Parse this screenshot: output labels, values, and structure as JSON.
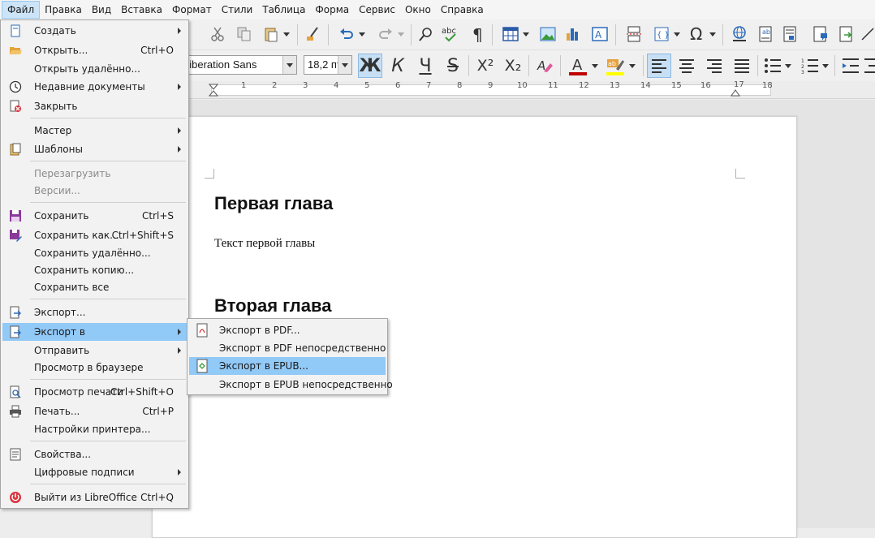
{
  "menubar": {
    "items": [
      "Файл",
      "Правка",
      "Вид",
      "Вставка",
      "Формат",
      "Стили",
      "Таблица",
      "Форма",
      "Сервис",
      "Окно",
      "Справка"
    ]
  },
  "toolbar": {
    "font_name": "Liberation Sans",
    "font_size": "18,2 пт",
    "bold_label": "Ж",
    "italic_label": "К",
    "underline_label": "Ч",
    "strike_label": "S",
    "superscript_label": "X²",
    "subscript_label": "X₂",
    "font_color": "#c00000",
    "highlight_color": "#ffff00"
  },
  "ruler": {
    "numbers": [
      "1",
      "2",
      "3",
      "4",
      "5",
      "6",
      "7",
      "8",
      "9",
      "10",
      "11",
      "12",
      "13",
      "14",
      "15",
      "16",
      "17",
      "18"
    ]
  },
  "document": {
    "heading1": "Первая глава",
    "text1": "Текст первой главы",
    "heading2": "Вторая глава"
  },
  "file_menu": {
    "items": [
      {
        "label": "Создать",
        "shortcut": "",
        "submenu": true,
        "disabled": false,
        "icon": "new-doc-icon"
      },
      {
        "label": "Открыть...",
        "shortcut": "Ctrl+O",
        "submenu": false,
        "disabled": false,
        "icon": "folder-open-icon"
      },
      {
        "label": "Открыть удалённо...",
        "shortcut": "",
        "submenu": false,
        "disabled": false,
        "icon": ""
      },
      {
        "label": "Недавние документы",
        "shortcut": "",
        "submenu": true,
        "disabled": false,
        "icon": "clock-icon"
      },
      {
        "label": "Закрыть",
        "shortcut": "",
        "submenu": false,
        "disabled": false,
        "icon": "close-doc-icon"
      },
      {
        "label": "Мастер",
        "shortcut": "",
        "submenu": true,
        "disabled": false,
        "icon": ""
      },
      {
        "label": "Шаблоны",
        "shortcut": "",
        "submenu": true,
        "disabled": false,
        "icon": "templates-icon"
      },
      {
        "label": "Перезагрузить",
        "shortcut": "",
        "submenu": false,
        "disabled": true,
        "icon": ""
      },
      {
        "label": "Версии...",
        "shortcut": "",
        "submenu": false,
        "disabled": true,
        "icon": ""
      },
      {
        "label": "Сохранить",
        "shortcut": "Ctrl+S",
        "submenu": false,
        "disabled": false,
        "icon": "save-icon"
      },
      {
        "label": "Сохранить как...",
        "shortcut": "Ctrl+Shift+S",
        "submenu": false,
        "disabled": false,
        "icon": "save-as-icon"
      },
      {
        "label": "Сохранить удалённо...",
        "shortcut": "",
        "submenu": false,
        "disabled": false,
        "icon": ""
      },
      {
        "label": "Сохранить копию...",
        "shortcut": "",
        "submenu": false,
        "disabled": false,
        "icon": ""
      },
      {
        "label": "Сохранить все",
        "shortcut": "",
        "submenu": false,
        "disabled": false,
        "icon": ""
      },
      {
        "label": "Экспорт...",
        "shortcut": "",
        "submenu": false,
        "disabled": false,
        "icon": "export-icon"
      },
      {
        "label": "Экспорт в",
        "shortcut": "",
        "submenu": true,
        "disabled": false,
        "icon": "export-to-icon"
      },
      {
        "label": "Отправить",
        "shortcut": "",
        "submenu": true,
        "disabled": false,
        "icon": ""
      },
      {
        "label": "Просмотр в браузере",
        "shortcut": "",
        "submenu": false,
        "disabled": false,
        "icon": ""
      },
      {
        "label": "Просмотр печати",
        "shortcut": "Ctrl+Shift+O",
        "submenu": false,
        "disabled": false,
        "icon": "print-preview-icon"
      },
      {
        "label": "Печать...",
        "shortcut": "Ctrl+P",
        "submenu": false,
        "disabled": false,
        "icon": "printer-icon"
      },
      {
        "label": "Настройки принтера...",
        "shortcut": "",
        "submenu": false,
        "disabled": false,
        "icon": ""
      },
      {
        "label": "Свойства...",
        "shortcut": "",
        "submenu": false,
        "disabled": false,
        "icon": "properties-icon"
      },
      {
        "label": "Цифровые подписи",
        "shortcut": "",
        "submenu": true,
        "disabled": false,
        "icon": ""
      },
      {
        "label": "Выйти из LibreOffice",
        "shortcut": "Ctrl+Q",
        "submenu": false,
        "disabled": false,
        "icon": "exit-icon"
      }
    ]
  },
  "export_submenu": {
    "items": [
      {
        "label": "Экспорт в PDF...",
        "icon": "pdf-icon"
      },
      {
        "label": "Экспорт в PDF непосредственно",
        "icon": ""
      },
      {
        "label": "Экспорт в EPUB...",
        "icon": "epub-icon"
      },
      {
        "label": "Экспорт в EPUB непосредственно",
        "icon": ""
      }
    ]
  }
}
